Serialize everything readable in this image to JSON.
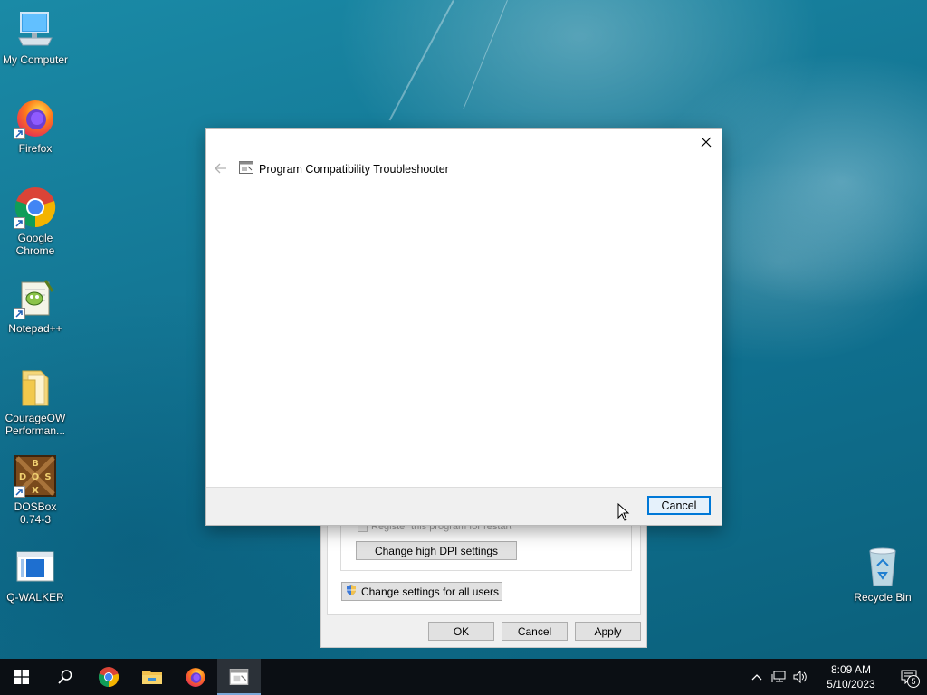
{
  "desktop": {
    "icons": [
      {
        "label": "My Computer",
        "icon": "computer-icon"
      },
      {
        "label": "Firefox",
        "icon": "firefox-icon"
      },
      {
        "label": "Google Chrome",
        "icon": "chrome-icon"
      },
      {
        "label": "Notepad++",
        "icon": "notepadpp-icon"
      },
      {
        "label": "CourageOW Performan...",
        "icon": "folder-icon"
      },
      {
        "label": "DOSBox 0.74-3",
        "icon": "dosbox-icon"
      },
      {
        "label": "Q-WALKER",
        "icon": "app-window-icon"
      },
      {
        "label": "Recycle Bin",
        "icon": "recycle-bin-icon"
      }
    ]
  },
  "troubleshooter": {
    "title": "Program Compatibility Troubleshooter",
    "cancel_label": "Cancel"
  },
  "properties": {
    "register_restart": "Register this program for restart",
    "dpi_button": "Change high DPI settings",
    "all_users_button": "Change settings for all users",
    "ok_label": "OK",
    "cancel_label": "Cancel",
    "apply_label": "Apply"
  },
  "taskbar": {
    "time": "8:09 AM",
    "date": "5/10/2023",
    "notification_count": "5"
  },
  "colors": {
    "accent": "#0078d7",
    "taskbar": "#0b0f14"
  }
}
